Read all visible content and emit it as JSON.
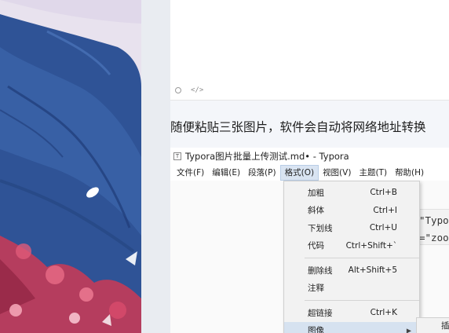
{
  "colors": {
    "art_sky": "#e9e1ee",
    "art_blue": "#2f5396",
    "art_dark_blue": "#1f3c78",
    "art_red": "#c43b58",
    "gutter": "#e9ecf1",
    "menu_active": "#d9e4f2"
  },
  "top_panel": {
    "icons": [
      "circle-icon",
      "code-icon"
    ],
    "code_glyph": "</>"
  },
  "article": {
    "text": "随便粘贴三张图片，软件会自动将网络地址转换"
  },
  "typora": {
    "title": "Typora图片批量上传测试.md• - Typora",
    "logo_glyph": "T",
    "menus": [
      {
        "label": "文件(F)"
      },
      {
        "label": "编辑(E)"
      },
      {
        "label": "段落(P)"
      },
      {
        "label": "格式(O)",
        "active": true
      },
      {
        "label": "视图(V)"
      },
      {
        "label": "主题(T)"
      },
      {
        "label": "帮助(H)"
      }
    ],
    "code_lines": [
      "\"Typor",
      "=\"zoo"
    ],
    "format_menu": {
      "group1": [
        {
          "label": "加粗",
          "shortcut": "Ctrl+B"
        },
        {
          "label": "斜体",
          "shortcut": "Ctrl+I"
        },
        {
          "label": "下划线",
          "shortcut": "Ctrl+U"
        },
        {
          "label": "代码",
          "shortcut": "Ctrl+Shift+`"
        }
      ],
      "group2": [
        {
          "label": "删除线",
          "shortcut": "Alt+Shift+5"
        },
        {
          "label": "注释",
          "shortcut": ""
        }
      ],
      "group3": [
        {
          "label": "超链接",
          "shortcut": "Ctrl+K"
        },
        {
          "label": "图像",
          "shortcut": "",
          "submenu": true
        }
      ]
    },
    "submenu_partial": "插"
  }
}
